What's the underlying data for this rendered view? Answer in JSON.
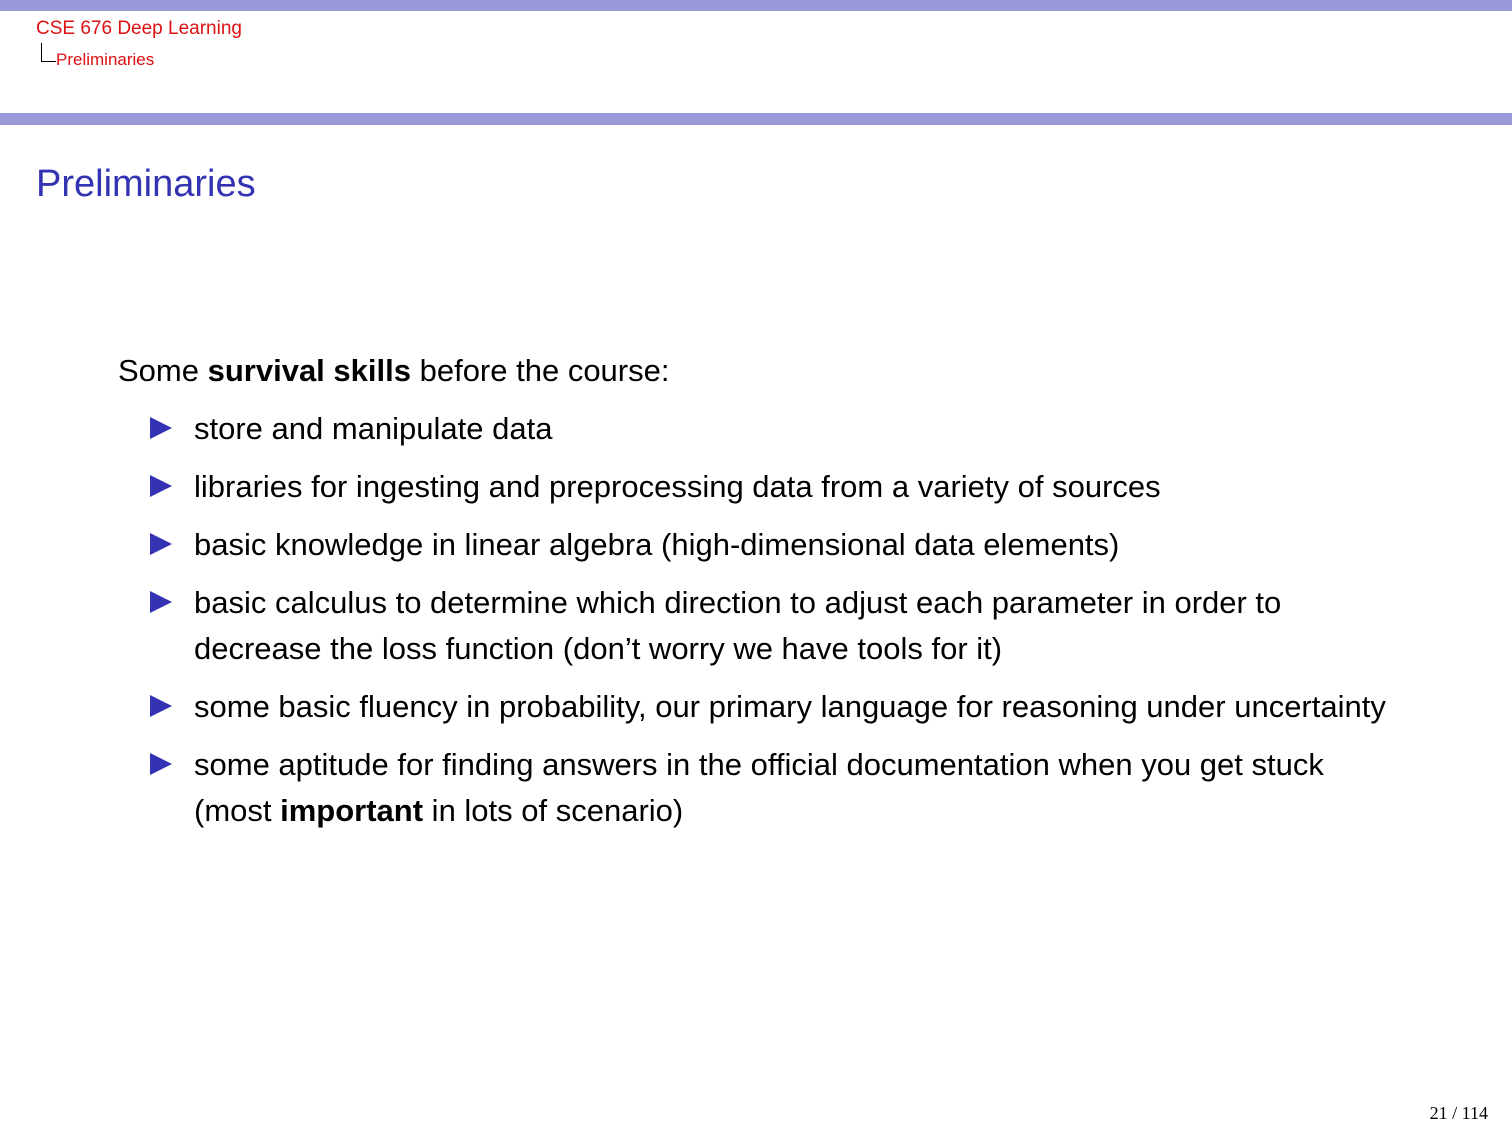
{
  "header": {
    "course_title": "CSE 676 Deep Learning",
    "section": "Preliminaries"
  },
  "slide": {
    "title": "Preliminaries",
    "intro": {
      "before": "Some ",
      "bold": "survival skills",
      "after": " before the course:"
    },
    "bullets": [
      "store and manipulate data",
      "libraries for ingesting and preprocessing data from a variety of sources",
      "basic knowledge in linear algebra (high-dimensional data elements)",
      "basic calculus to determine which direction to adjust each parameter in order to decrease the loss function (don’t worry we have tools for it)",
      "some basic fluency in probability, our primary language for reasoning under uncertainty"
    ],
    "last_bullet": {
      "before": "some aptitude for finding answers in the official documentation when you get stuck (most ",
      "bold": "important",
      "after": " in lots of scenario)"
    }
  },
  "footer": {
    "page_current": "21",
    "page_separator": "/",
    "page_total": "114"
  },
  "colors": {
    "bar": "#9999d9",
    "title": "#3333b3",
    "header_text": "#dd1111",
    "bullet": "#3333b3"
  }
}
